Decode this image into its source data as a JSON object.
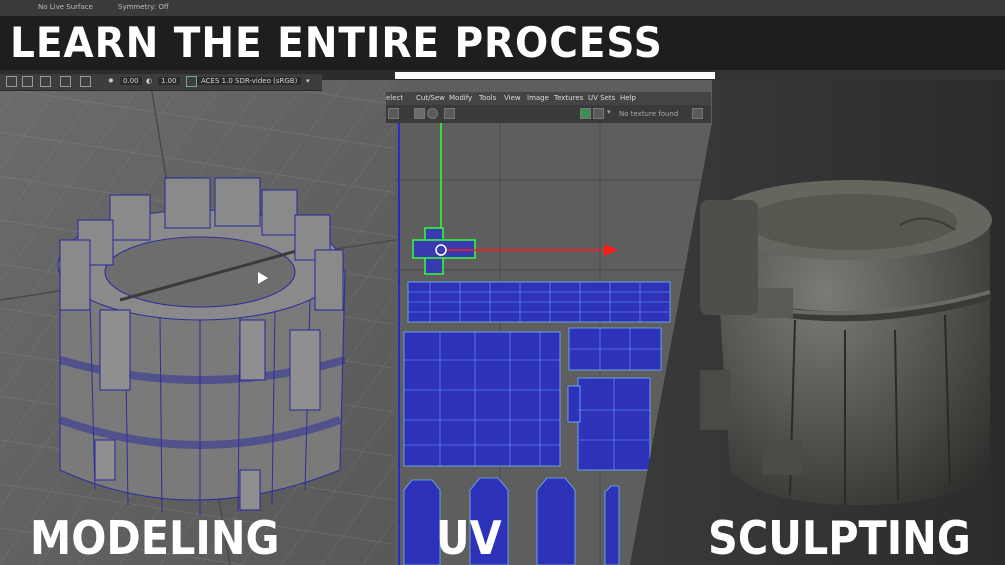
{
  "banner": {
    "title": "LEARN THE ENTIRE PROCESS"
  },
  "top_strip": {
    "left_text": "No Live Surface",
    "right_text": "Symmetry: Off"
  },
  "maya": {
    "field_a": "0.00",
    "field_b": "1.00",
    "color_space": "ACES 1.0 SDR-video (sRGB)"
  },
  "uv_editor": {
    "menu": [
      "elect",
      "Cut/Sew",
      "Modify",
      "Tools",
      "View",
      "Image",
      "Textures",
      "UV Sets",
      "Help"
    ],
    "texture_status": "No texture found"
  },
  "sections": {
    "modeling": "MODELING",
    "uv": "UV",
    "sculpting": "SCULPTING"
  },
  "colors": {
    "uv_blue": "#2e32b8",
    "uv_green": "#2fff3a",
    "arrow_red": "#ff1a1a",
    "banner_bg": "#1e1e1e"
  }
}
